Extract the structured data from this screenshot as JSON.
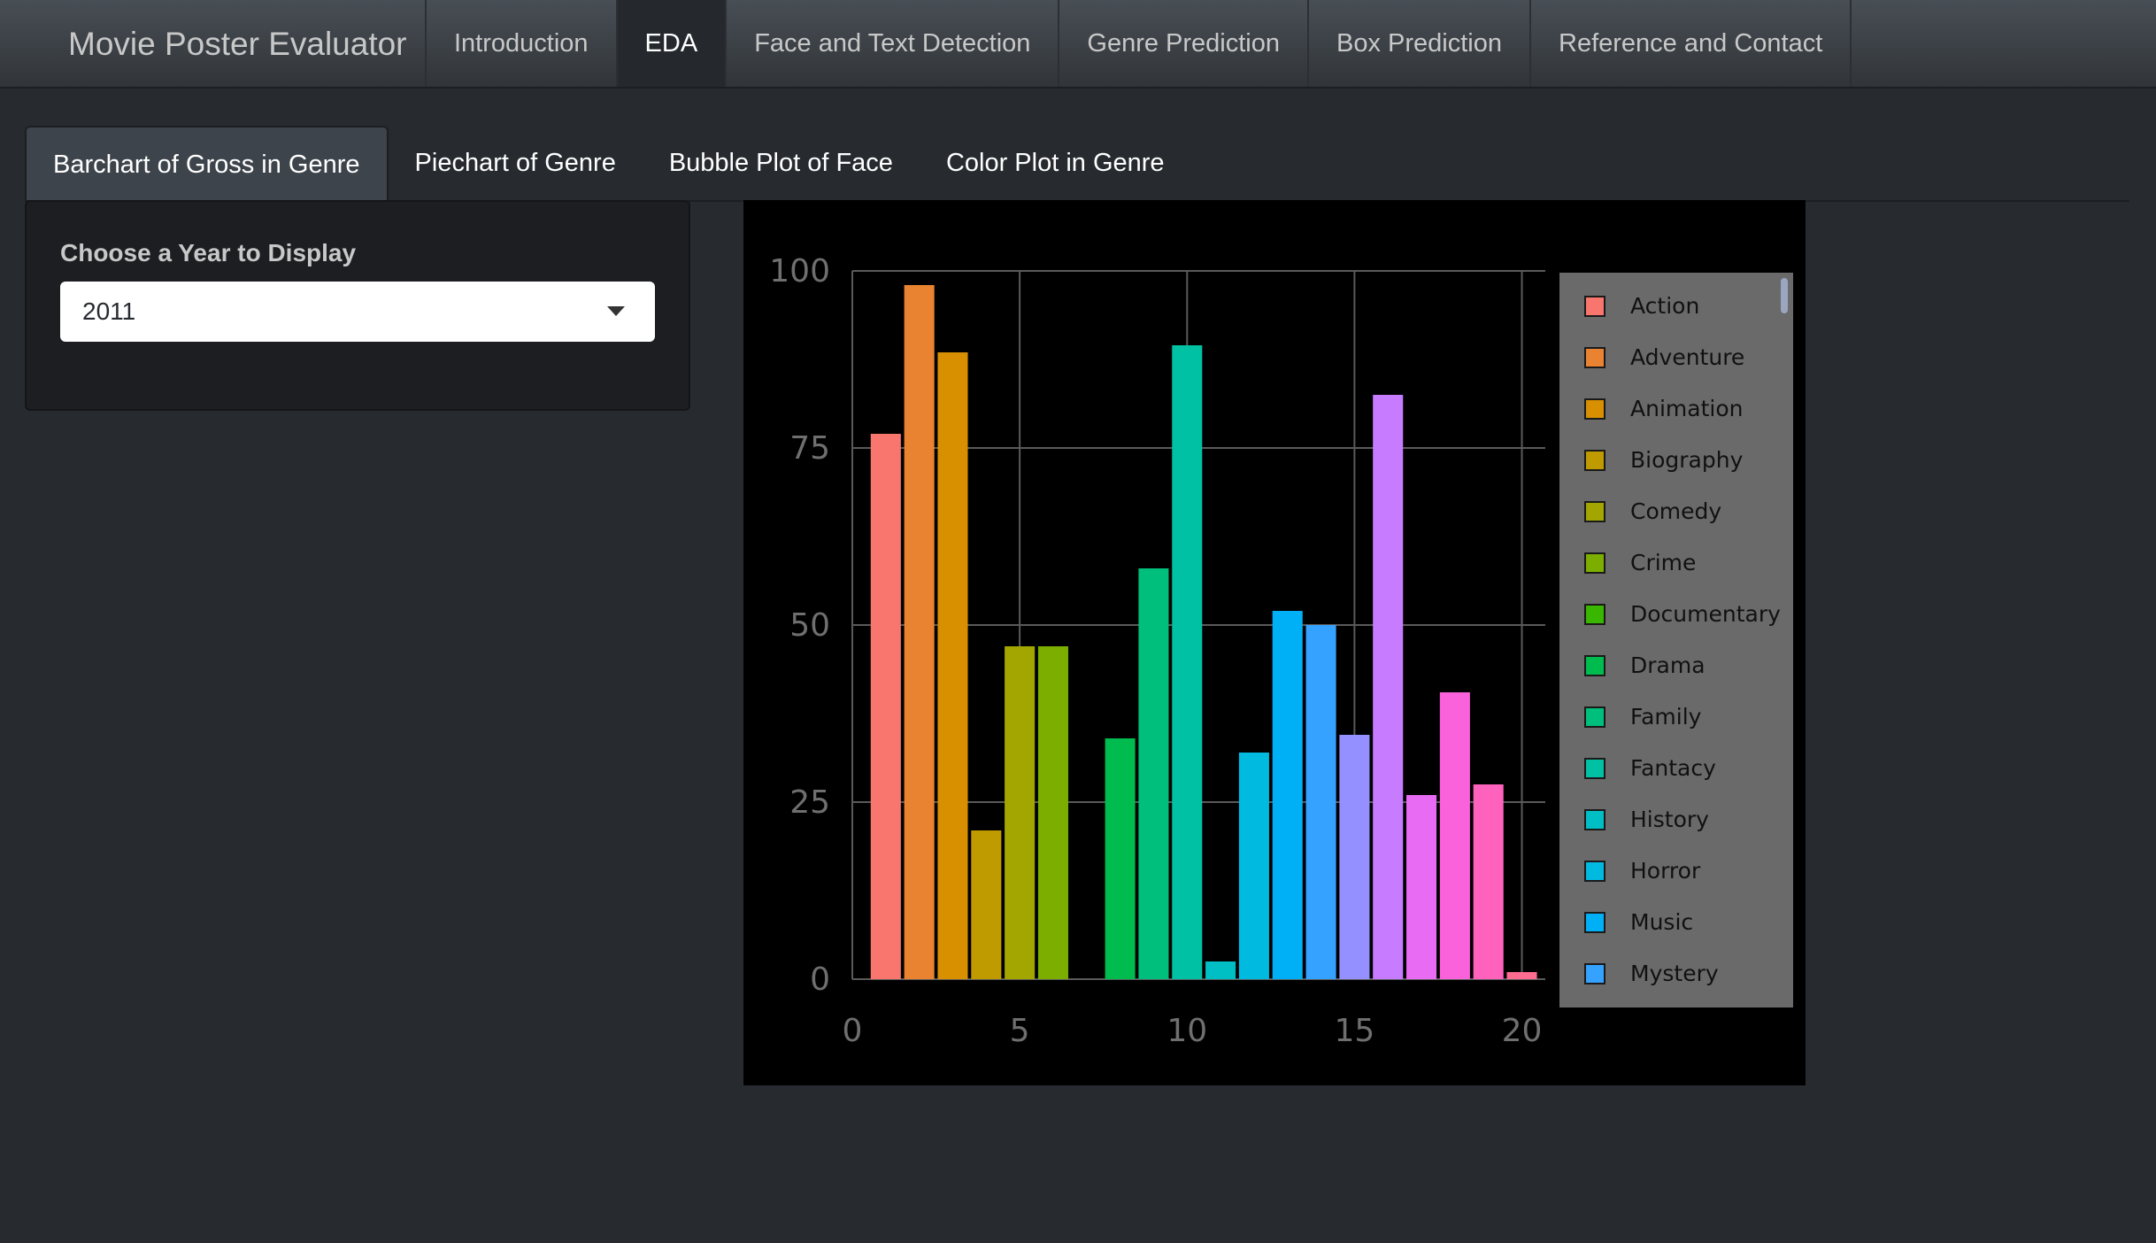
{
  "navbar": {
    "brand": "Movie Poster Evaluator",
    "items": [
      {
        "label": "Introduction",
        "active": false
      },
      {
        "label": "EDA",
        "active": true
      },
      {
        "label": "Face and Text Detection",
        "active": false
      },
      {
        "label": "Genre Prediction",
        "active": false
      },
      {
        "label": "Box Prediction",
        "active": false
      },
      {
        "label": "Reference and Contact",
        "active": false
      }
    ]
  },
  "tabs": [
    {
      "label": "Barchart of Gross in Genre",
      "active": true
    },
    {
      "label": "Piechart of Genre",
      "active": false
    },
    {
      "label": "Bubble Plot of Face",
      "active": false
    },
    {
      "label": "Color Plot in Genre",
      "active": false
    }
  ],
  "sidebar": {
    "year_label": "Choose a Year to Display",
    "year_value": "2011"
  },
  "chart_data": {
    "type": "bar",
    "xlim": [
      0,
      20.7
    ],
    "ylim": [
      0,
      100
    ],
    "x_ticks": [
      0,
      5,
      10,
      15,
      20
    ],
    "y_ticks": [
      0,
      25,
      50,
      75,
      100
    ],
    "grid": true,
    "legend_position": "right",
    "background": "#000000",
    "series": [
      {
        "name": "Action",
        "x": 1,
        "value": 77,
        "color": "#f8766d"
      },
      {
        "name": "Adventure",
        "x": 2,
        "value": 98,
        "color": "#ea8331"
      },
      {
        "name": "Animation",
        "x": 3,
        "value": 88.5,
        "color": "#d89000"
      },
      {
        "name": "Biography",
        "x": 4,
        "value": 21,
        "color": "#c09b00"
      },
      {
        "name": "Comedy",
        "x": 5,
        "value": 47,
        "color": "#a3a500"
      },
      {
        "name": "Crime",
        "x": 6,
        "value": 47,
        "color": "#7cae00"
      },
      {
        "name": "Documentary",
        "x": 7,
        "value": 0,
        "color": "#39b600"
      },
      {
        "name": "Drama",
        "x": 8,
        "value": 34,
        "color": "#00bb4e"
      },
      {
        "name": "Family",
        "x": 9,
        "value": 58,
        "color": "#00bf7d"
      },
      {
        "name": "Fantacy",
        "x": 10,
        "value": 89.5,
        "color": "#00c1a3"
      },
      {
        "name": "History",
        "x": 11,
        "value": 2.5,
        "color": "#00bfc4"
      },
      {
        "name": "Horror",
        "x": 12,
        "value": 32,
        "color": "#00bae0"
      },
      {
        "name": "Music",
        "x": 13,
        "value": 52,
        "color": "#00b0f6"
      },
      {
        "name": "Mystery",
        "x": 14,
        "value": 50,
        "color": "#35a2ff"
      },
      {
        "name": "",
        "x": 15,
        "value": 34.5,
        "color": "#9590ff"
      },
      {
        "name": "",
        "x": 16,
        "value": 82.5,
        "color": "#c77cff"
      },
      {
        "name": "",
        "x": 17,
        "value": 26,
        "color": "#e76bf3"
      },
      {
        "name": "",
        "x": 18,
        "value": 40.5,
        "color": "#fa62db"
      },
      {
        "name": "",
        "x": 19,
        "value": 27.5,
        "color": "#ff62bc"
      },
      {
        "name": "",
        "x": 20,
        "value": 1,
        "color": "#ff6c91"
      }
    ],
    "legend": [
      {
        "name": "Action",
        "color": "#f8766d"
      },
      {
        "name": "Adventure",
        "color": "#ea8331"
      },
      {
        "name": "Animation",
        "color": "#d89000"
      },
      {
        "name": "Biography",
        "color": "#c09b00"
      },
      {
        "name": "Comedy",
        "color": "#a3a500"
      },
      {
        "name": "Crime",
        "color": "#7cae00"
      },
      {
        "name": "Documentary",
        "color": "#39b600"
      },
      {
        "name": "Drama",
        "color": "#00bb4e"
      },
      {
        "name": "Family",
        "color": "#00bf7d"
      },
      {
        "name": "Fantacy",
        "color": "#00c1a3"
      },
      {
        "name": "History",
        "color": "#00bfc4"
      },
      {
        "name": "Horror",
        "color": "#00bae0"
      },
      {
        "name": "Music",
        "color": "#00b0f6"
      },
      {
        "name": "Mystery",
        "color": "#35a2ff"
      }
    ]
  }
}
